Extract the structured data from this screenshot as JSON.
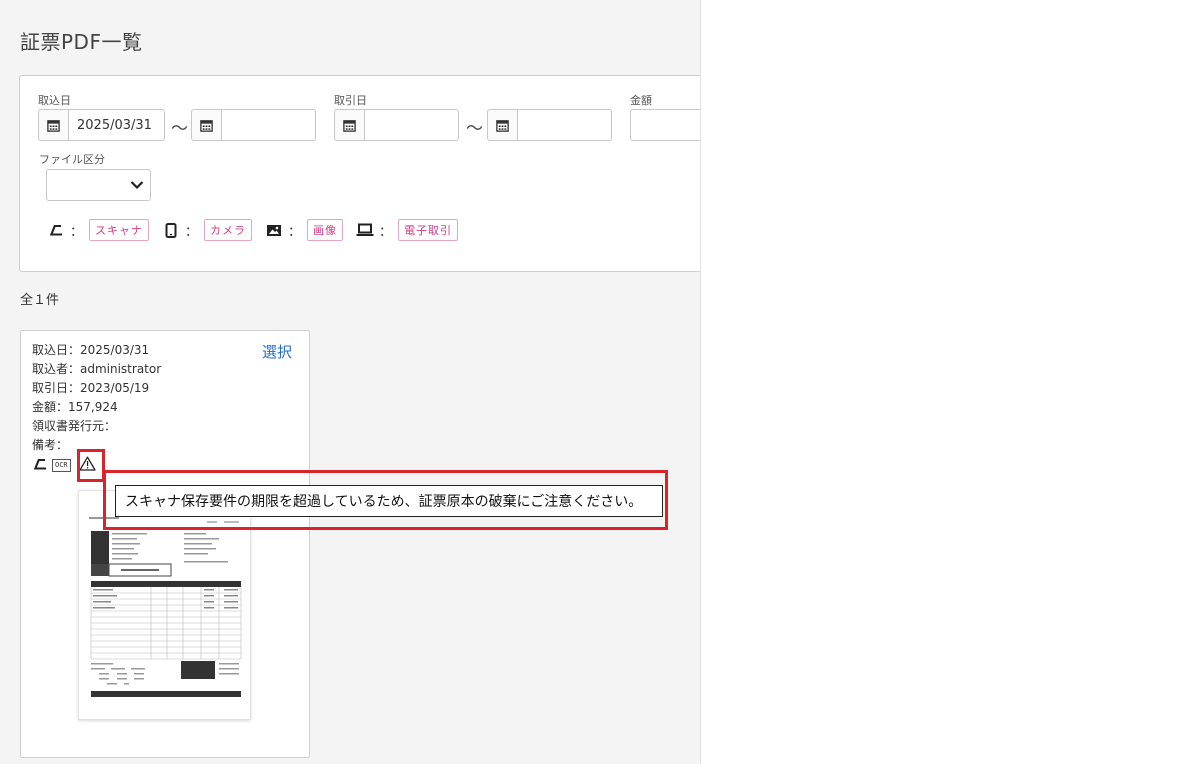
{
  "page": {
    "title": "証票PDF一覧"
  },
  "search": {
    "import_date": {
      "label": "取込日",
      "from_value": "2025/03/31",
      "to_value": ""
    },
    "transaction_date": {
      "label": "取引日",
      "from_value": "",
      "to_value": ""
    },
    "amount": {
      "label": "金額",
      "value": ""
    },
    "file_type": {
      "label": "ファイル区分",
      "selected": ""
    },
    "range_separator": "～",
    "legend": [
      {
        "icon": "scanner-icon",
        "label": "スキャナ"
      },
      {
        "icon": "phone-icon",
        "label": "カメラ"
      },
      {
        "icon": "image-icon",
        "label": "画像"
      },
      {
        "icon": "laptop-icon",
        "label": "電子取引"
      }
    ],
    "legend_colon": "：",
    "tag_color": "#d83a84"
  },
  "results": {
    "count_text": "全１件",
    "cards": [
      {
        "lines": [
          "取込日：2025/03/31",
          "取込者：administrator",
          "取引日：2023/05/19",
          "金額：157,924",
          "領収書発行元：",
          "備考："
        ],
        "select_label": "選択",
        "badges": [
          "scanner-icon",
          "OCR",
          "warning-icon"
        ],
        "ocr_label": "OCR"
      }
    ]
  },
  "tooltip": {
    "text": "スキャナ保存要件の期限を超過しているため、証票原本の破棄にご注意ください。",
    "highlight_color": "#d8242a"
  }
}
